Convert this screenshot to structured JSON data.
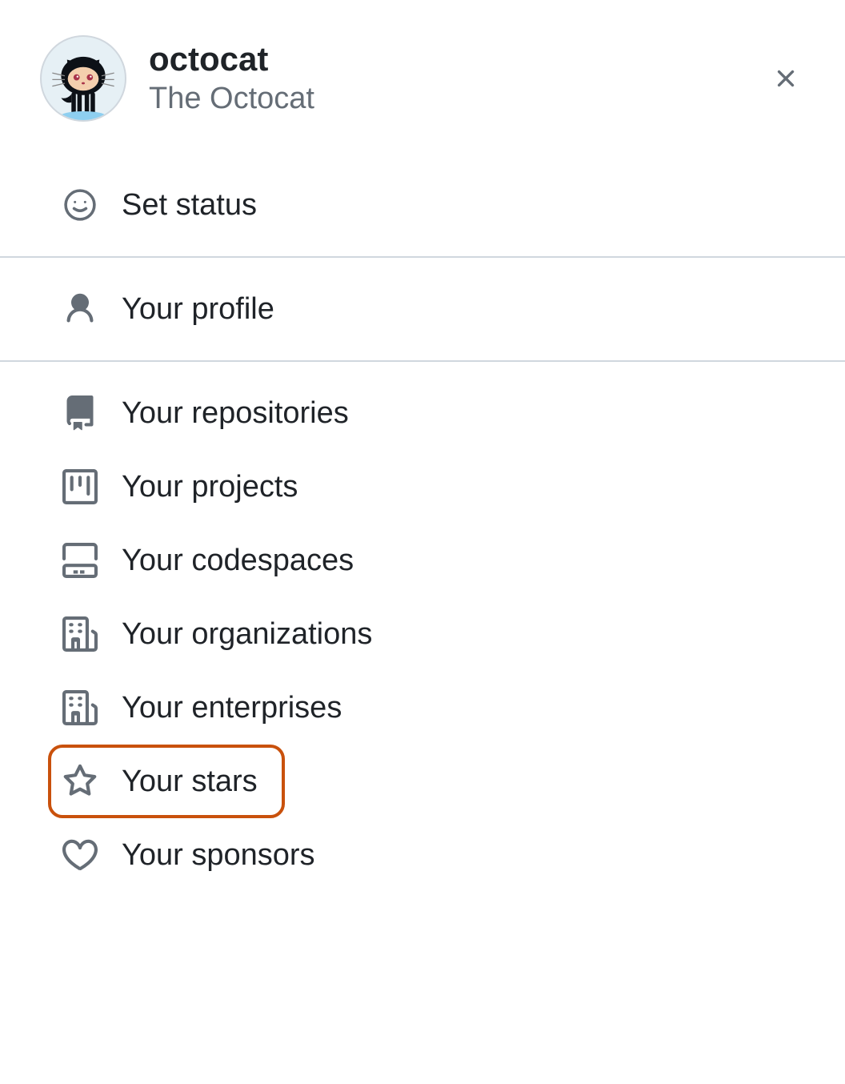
{
  "header": {
    "username": "octocat",
    "display_name": "The Octocat"
  },
  "menu": {
    "set_status": "Set status",
    "your_profile": "Your profile",
    "your_repositories": "Your repositories",
    "your_projects": "Your projects",
    "your_codespaces": "Your codespaces",
    "your_organizations": "Your organizations",
    "your_enterprises": "Your enterprises",
    "your_stars": "Your stars",
    "your_sponsors": "Your sponsors"
  },
  "highlight_color": "#c9510c"
}
